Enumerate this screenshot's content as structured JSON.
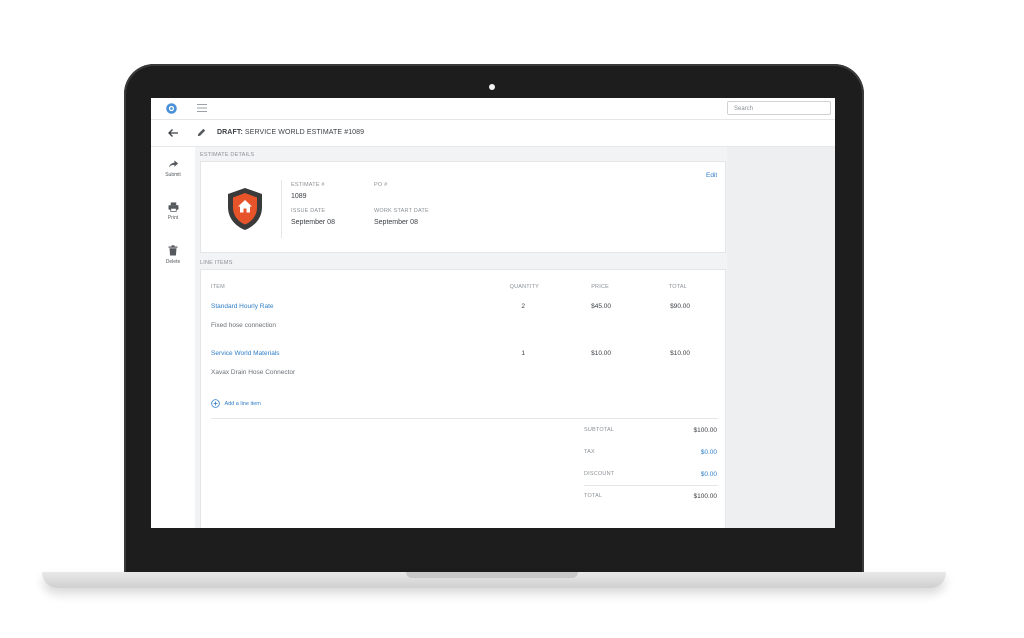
{
  "topbar": {
    "search_placeholder": "Search"
  },
  "header": {
    "title_prefix": "DRAFT:",
    "title": "SERVICE WORLD ESTIMATE #1089"
  },
  "sidebar": {
    "items": [
      {
        "label": "Submit",
        "icon": "share-arrow-icon"
      },
      {
        "label": "Print",
        "icon": "printer-icon"
      },
      {
        "label": "Delete",
        "icon": "trash-icon"
      }
    ]
  },
  "estimate_details": {
    "section_label": "ESTIMATE DETAILS",
    "edit_label": "Edit",
    "estimate_num_label": "ESTIMATE #",
    "estimate_num": "1089",
    "po_label": "PO #",
    "po_value": "",
    "issue_date_label": "ISSUE DATE",
    "issue_date": "September 08",
    "work_start_label": "WORK START DATE",
    "work_start": "September 08"
  },
  "line_items": {
    "section_label": "LINE ITEMS",
    "columns": {
      "item": "ITEM",
      "quantity": "QUANTITY",
      "price": "PRICE",
      "total": "TOTAL"
    },
    "rows": [
      {
        "name": "Standard Hourly Rate",
        "description": "Fixed hose connection",
        "quantity": "2",
        "price": "$45.00",
        "total": "$90.00"
      },
      {
        "name": "Service World Materials",
        "description": "Xavax Drain Hose Connector",
        "quantity": "1",
        "price": "$10.00",
        "total": "$10.00"
      }
    ],
    "add_label": "Add a line item"
  },
  "totals": {
    "subtotal_label": "SUBTOTAL",
    "subtotal": "$100.00",
    "tax_label": "TAX",
    "tax": "$0.00",
    "discount_label": "DISCOUNT",
    "discount": "$0.00",
    "total_label": "TOTAL",
    "total": "$100.00"
  },
  "colors": {
    "accent": "#2f7dc7",
    "shield_orange": "#e8542a",
    "shield_dark": "#3a3a3a",
    "logo_blue": "#4a90d9"
  }
}
